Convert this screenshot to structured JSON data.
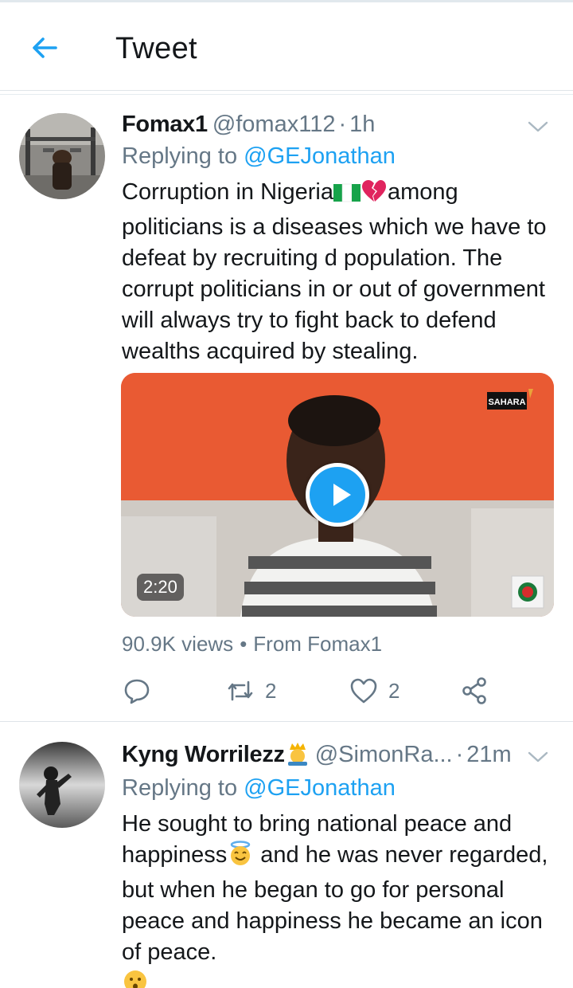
{
  "header": {
    "title": "Tweet"
  },
  "tweets": [
    {
      "name": "Fomax1",
      "handle": "@fomax112",
      "dot": "·",
      "time": "1h",
      "replying_prefix": "Replying to",
      "replying_to": "@GEJonathan",
      "text_before_emoji": "Corruption in Nigeria",
      "text_after_emoji": "among politicians is a diseases which we have to defeat by recruiting d population. The corrupt politicians in or out of government will always try to fight back to defend wealths acquired by stealing.",
      "emojis": [
        "flag-nigeria-emoji",
        "broken-heart-emoji"
      ],
      "video": {
        "duration": "2:20",
        "watermark": "SAHARA"
      },
      "views": "90.9K views",
      "stats_sep": "•",
      "from": "From Fomax1",
      "retweets": "2",
      "likes": "2",
      "icons": [
        "reply-icon",
        "retweet-icon",
        "like-icon",
        "share-icon",
        "chevron-down-icon"
      ]
    },
    {
      "name": "Kyng Worrilezz",
      "name_emoji": "prince-emoji",
      "handle": "@SimonRa...",
      "dot": "·",
      "time": "21m",
      "replying_prefix": "Replying to",
      "replying_to": "@GEJonathan",
      "text_line1": "He sought to bring national peace and happiness",
      "text_rest": " and he was never regarded, but when he began to go for personal peace and happiness he became an icon of peace.",
      "emojis": [
        "halo-smile-emoji",
        "hushed-face-emoji"
      ]
    }
  ],
  "colors": {
    "accent": "#1da1f2",
    "secondary_text": "#657786",
    "primary_text": "#14171a",
    "divider": "#dfe4e8"
  }
}
